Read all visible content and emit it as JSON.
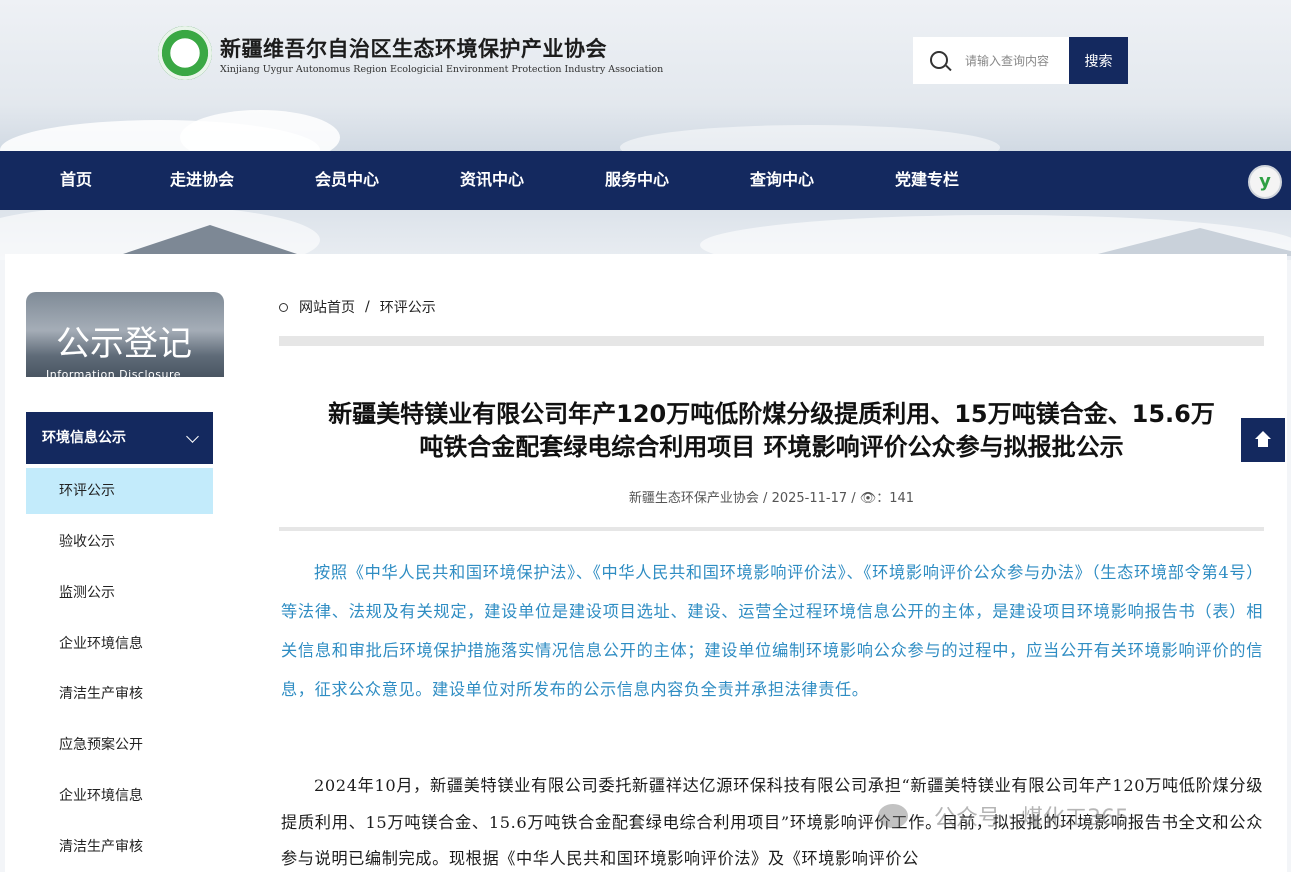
{
  "header": {
    "org_name": "新疆维吾尔自治区生态环境保护产业协会",
    "org_name_en": "Xinjiang Uygur Autonomus Region Ecologicial Environment Protection Industry Association",
    "search_placeholder": "请输入查询内容",
    "search_button": "搜索"
  },
  "nav": {
    "items": [
      "首页",
      "走进协会",
      "会员中心",
      "资讯中心",
      "服务中心",
      "查询中心",
      "党建专栏"
    ],
    "badge": "y"
  },
  "sidebar": {
    "banner_title": "公示登记",
    "banner_subtitle": "Information Disclosure",
    "section_title": "环境信息公示",
    "items": [
      "环评公示",
      "验收公示",
      "监测公示",
      "企业环境信息",
      "清洁生产审核",
      "应急预案公开",
      "企业环境信息",
      "清洁生产审核"
    ],
    "active_index": 0
  },
  "breadcrumb": {
    "home": "网站首页",
    "separator": "/",
    "current": "环评公示"
  },
  "article": {
    "title_line1": "新疆美特镁业有限公司年产120万吨低阶煤分级提质利用、15万吨镁合金、15.6万",
    "title_line2": "吨铁合金配套绿电综合利用项目 环境影响评价公众参与拟报批公示",
    "meta": "新疆生态环保产业协会 / 2025-11-17 / 👁：141",
    "paragraph1": "按照《中华人民共和国环境保护法》、《中华人民共和国环境影响评价法》、《环境影响评价公众参与办法》（生态环境部令第4号）等法律、法规及有关规定，建设单位是建设项目选址、建设、运营全过程环境信息公开的主体，是建设项目环境影响报告书（表）相关信息和审批后环境保护措施落实情况信息公开的主体；建设单位编制环境影响公众参与的过程中，应当公开有关环境影响评价的信息，征求公众意见。建设单位对所发布的公示信息内容负全责并承担法律责任。",
    "paragraph2": "2024年10月，新疆美特镁业有限公司委托新疆祥达亿源环保科技有限公司承担“新疆美特镁业有限公司年产120万吨低阶煤分级提质利用、15万吨镁合金、15.6万吨铁合金配套绿电综合利用项目”环境影响评价工作。目前，拟报批的环境影响报告书全文和公众参与说明已编制完成。现根据《中华人民共和国环境影响评价法》及《环境影响评价公"
  },
  "watermark": "公众号 · 煤化工365",
  "colors": {
    "navy": "#14295f",
    "active_item": "#c3ebfb",
    "link_blue": "#2f8dc3"
  }
}
